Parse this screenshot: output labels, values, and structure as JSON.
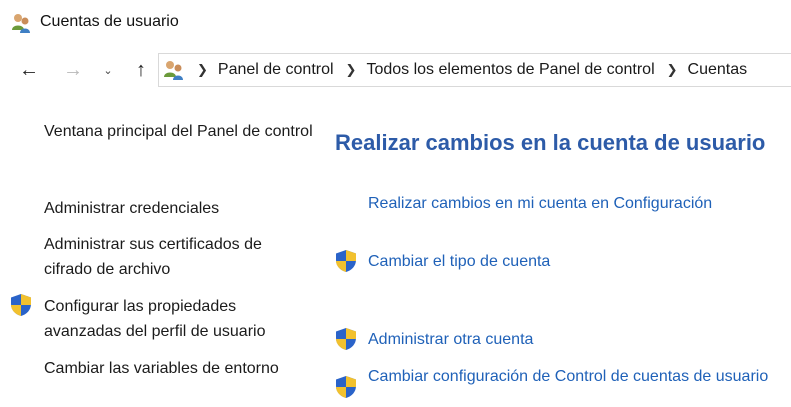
{
  "window": {
    "title": "Cuentas de usuario",
    "icon": "user-accounts-icon"
  },
  "navigation": {
    "back": "←",
    "forward": "→",
    "recent": "⌄",
    "up": "↑",
    "breadcrumb_separator": "❯",
    "breadcrumbs": [
      "Panel de control",
      "Todos los elementos de Panel de control",
      "Cuentas"
    ]
  },
  "sidebar": {
    "items": [
      {
        "label": "Ventana principal del Panel de control",
        "icon": null
      },
      {
        "label": "Administrar credenciales",
        "icon": null
      },
      {
        "label": "Administrar sus certificados de cifrado de archivo",
        "icon": null
      },
      {
        "label": "Configurar las propiedades avanzadas del perfil de usuario",
        "icon": "shield-icon"
      },
      {
        "label": "Cambiar las variables de entorno",
        "icon": null
      }
    ]
  },
  "main": {
    "heading": "Realizar cambios en la cuenta de usuario",
    "tasks": [
      {
        "label": "Realizar cambios en mi cuenta en Configuración",
        "icon": null
      },
      {
        "label": "Cambiar el tipo de cuenta",
        "icon": "shield-icon"
      },
      {
        "label": "Administrar otra cuenta",
        "icon": "shield-icon"
      },
      {
        "label": "Cambiar configuración de Control de cuentas de usuario",
        "icon": "shield-icon"
      }
    ]
  },
  "colors": {
    "heading": "#2d5ba8",
    "link": "#1f61b8",
    "shield_blue": "#2a63c9",
    "shield_yellow": "#f2c12e"
  }
}
